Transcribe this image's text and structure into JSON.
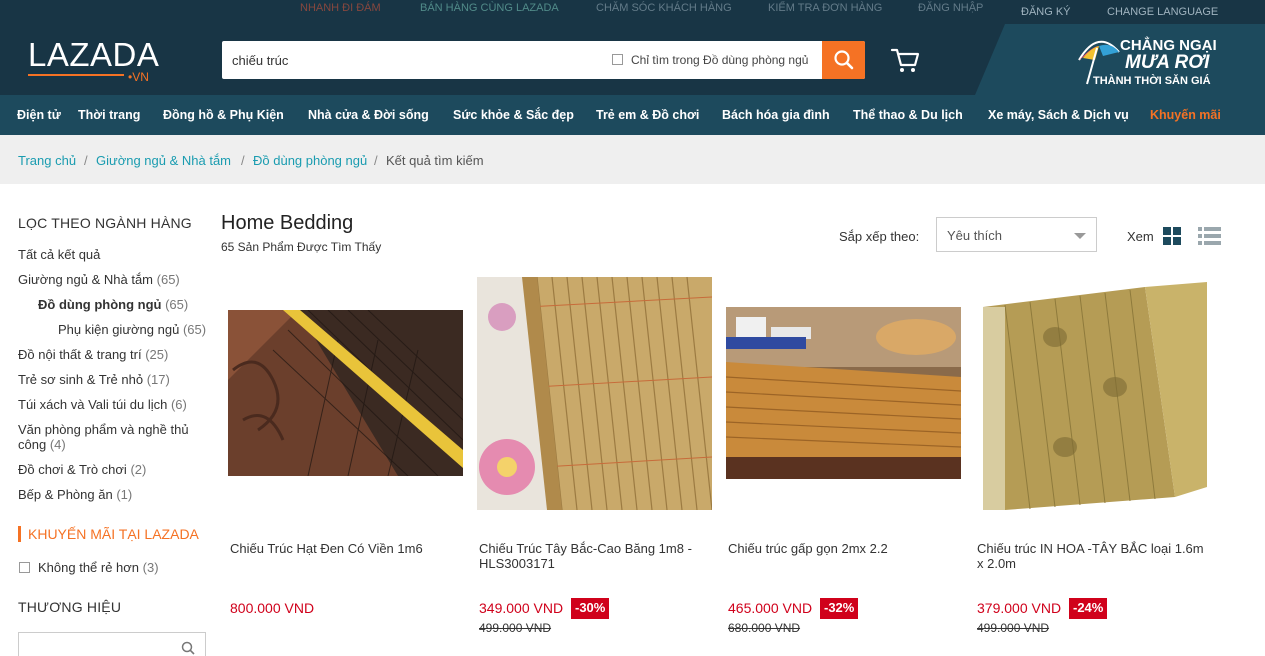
{
  "top_links": {
    "link1": "Nhanh đi đám",
    "link2": "Bán hàng cùng Lazada",
    "link3": "Chăm sóc khách hàng",
    "link4": "Kiểm tra đơn hàng",
    "link5": "Đăng nhập",
    "register": "ĐĂNG KÝ",
    "language": "CHANGE LANGUAGE"
  },
  "header": {
    "logo": "LAZADA",
    "logo_suffix": "•VN",
    "search_value": "chiếu trúc",
    "search_scope_label": "Chỉ tìm trong Đồ dùng phòng ngủ",
    "search_icon": "search-icon",
    "cart_icon": "cart-icon",
    "promo_line1": "CHẲNG NGẠI",
    "promo_line2": "MƯA RƠI",
    "promo_line3": "THÀNH THỜI SĂN GIÁ"
  },
  "categories": [
    "Điện tử",
    "Thời trang",
    "Đồng hồ & Phụ Kiện",
    "Nhà cửa & Đời sống",
    "Sức khỏe & Sắc đẹp",
    "Trẻ em & Đồ chơi",
    "Bách hóa gia đình",
    "Thể thao & Du lịch",
    "Xe máy, Sách & Dịch vụ",
    "Khuyến mãi"
  ],
  "breadcrumb": [
    "Trang chủ",
    "Giường ngủ & Nhà tắm",
    "Đồ dùng phòng ngủ",
    "Kết quả tìm kiếm"
  ],
  "sidebar": {
    "filter_heading": "LỌC THEO NGÀNH HÀNG",
    "filters": [
      {
        "label": "Tất cả kết quả",
        "count": ""
      },
      {
        "label": "Giường ngủ & Nhà tắm",
        "count": "(65)"
      },
      {
        "label": "Đồ dùng phòng ngủ",
        "count": "(65)"
      },
      {
        "label": "Phụ kiện giường ngủ",
        "count": "(65)"
      },
      {
        "label": "Đồ nội thất & trang trí",
        "count": "(25)"
      },
      {
        "label": "Trẻ sơ sinh & Trẻ nhỏ",
        "count": "(17)"
      },
      {
        "label": "Túi xách và Vali túi du lịch",
        "count": "(6)"
      },
      {
        "label": "Văn phòng phẩm và nghề thủ",
        "label2": "công",
        "count": "(4)"
      },
      {
        "label": "Đồ chơi & Trò chơi",
        "count": "(2)"
      },
      {
        "label": "Bếp & Phòng ăn",
        "count": "(1)"
      }
    ],
    "promo_heading": "KHUYẾN MÃI TẠI LAZADA",
    "promo_option": {
      "label": "Không thể rẻ hơn",
      "count": "(3)"
    },
    "brand_heading": "THƯƠNG HIỆU"
  },
  "results": {
    "title": "Home Bedding",
    "count": "65 Sản Phẩm Được Tìm Thấy",
    "sort_label": "Sắp xếp theo:",
    "sort_value": "Yêu thích",
    "view_label": "Xem"
  },
  "products": [
    {
      "name": "Chiếu Trúc Hạt Đen Có Viền 1m6",
      "price": "800.000 VND",
      "discount": "",
      "old_price": ""
    },
    {
      "name": "Chiếu Trúc Tây Bắc-Cao Băng 1m8 - HLS3003171",
      "price": "349.000 VND",
      "discount": "-30%",
      "old_price": "499.000 VND"
    },
    {
      "name": "Chiếu trúc gấp gọn 2mx 2.2",
      "price": "465.000 VND",
      "discount": "-32%",
      "old_price": "680.000 VND"
    },
    {
      "name": "Chiếu trúc IN HOA -TÂY BẮC loại 1.6m x 2.0m",
      "price": "379.000 VND",
      "discount": "-24%",
      "old_price": "499.000 VND"
    }
  ],
  "colors": {
    "header_bg": "#183545",
    "nav_bg": "#1d4a5d",
    "accent": "#f57224",
    "link": "#1a9cb0",
    "price": "#d0011b"
  }
}
